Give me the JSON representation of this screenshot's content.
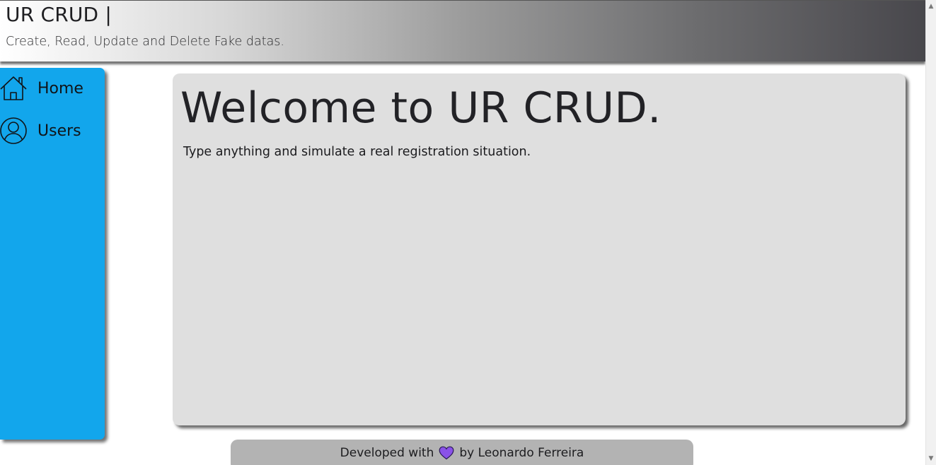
{
  "header": {
    "title": "UR CRUD |",
    "subtitle": "Create, Read, Update and Delete Fake datas."
  },
  "sidebar": {
    "items": [
      {
        "label": "Home",
        "icon": "home-icon"
      },
      {
        "label": "Users",
        "icon": "user-icon"
      }
    ]
  },
  "main": {
    "title": "Welcome to UR CRUD.",
    "description": "Type anything and simulate a real registration situation."
  },
  "footer": {
    "prefix": "Developed with",
    "suffix": "by Leonardo Ferreira",
    "icon": "heart-icon"
  },
  "colors": {
    "sidebar": "#12a6ec",
    "card": "#dfdfdf",
    "footer": "#b3b3b3",
    "heart": "#8a52e8"
  }
}
